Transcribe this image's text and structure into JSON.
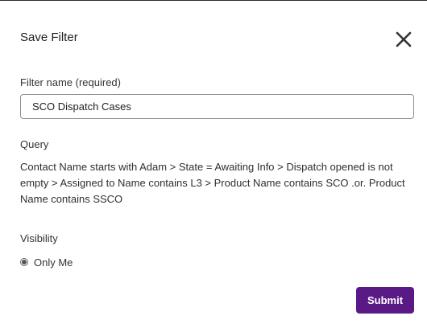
{
  "dialog": {
    "title": "Save Filter",
    "close_icon": "close-icon"
  },
  "filter_name": {
    "label": "Filter name (required)",
    "value": "SCO Dispatch Cases"
  },
  "query": {
    "label": "Query",
    "text": "Contact Name starts with Adam > State = Awaiting Info > Dispatch opened is not empty > Assigned to Name contains L3 > Product Name contains SCO .or. Product Name contains SSCO"
  },
  "visibility": {
    "label": "Visibility",
    "options": [
      {
        "label": "Only Me",
        "selected": true
      }
    ]
  },
  "actions": {
    "submit_label": "Submit"
  },
  "colors": {
    "accent": "#5a1a86",
    "text": "#2a2a2a",
    "border": "#8e8e8e"
  }
}
